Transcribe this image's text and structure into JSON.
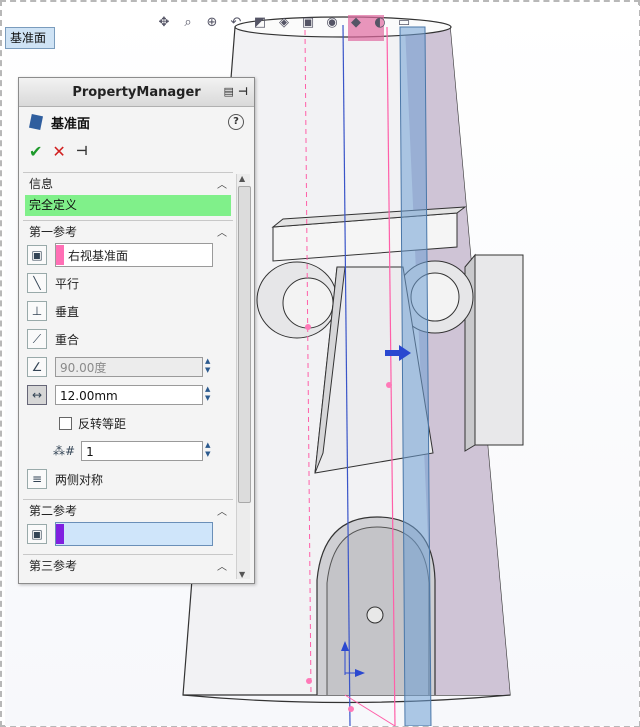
{
  "breadcrumb": "基准面",
  "toolbar_icons": [
    "pan-icon",
    "zoom-fit-icon",
    "zoom-area-icon",
    "previous-view-icon",
    "section-view-icon",
    "view-orientation-icon",
    "display-style-icon",
    "hide-show-icon",
    "edit-appearance-icon",
    "scene-icon",
    "view-settings-icon"
  ],
  "property_manager": {
    "title": "PropertyManager",
    "feature_name": "基准面",
    "help": "?",
    "ok": "✔",
    "cancel": "✕",
    "pin": "⊣",
    "info": {
      "header": "信息",
      "status": "完全定义"
    },
    "ref1": {
      "header": "第一参考",
      "selection": "右视基准面",
      "options": {
        "parallel": "平行",
        "perpendicular": "垂直",
        "coincident": "重合"
      },
      "angle": "90.00度",
      "distance": "12.00mm",
      "flip_offset": "反转等距",
      "count": "1",
      "mid_plane": "两侧对称"
    },
    "ref2": {
      "header": "第二参考",
      "selection": ""
    },
    "ref3": {
      "header": "第三参考"
    }
  },
  "colors": {
    "status_green": "#80f08a",
    "ref1_color": "#ff6fb5",
    "ref2_color": "#8020e0",
    "plane_blue": "#6d9ed4"
  }
}
